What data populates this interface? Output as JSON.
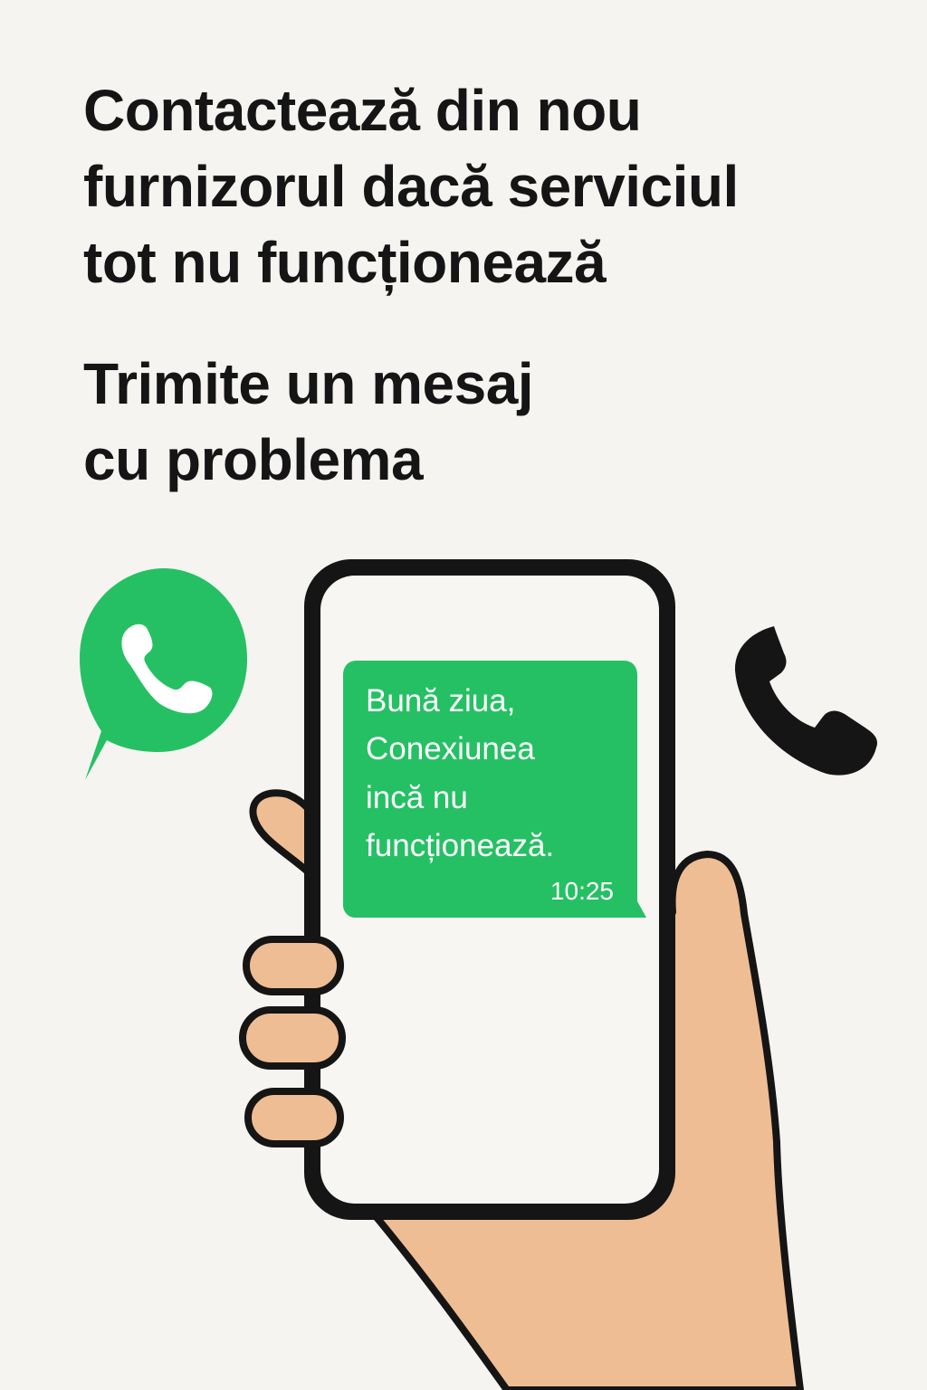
{
  "headline": {
    "lines": [
      "Contactează din nou",
      "furnizorul dacă serviciul",
      "tot nu funcționează"
    ]
  },
  "subheadline": {
    "lines": [
      "Trimite un mesaj",
      "cu problema"
    ]
  },
  "message": {
    "lines": [
      "Bună ziua,",
      "Conexiunea",
      "incă nu",
      "funcționează."
    ],
    "time": "10:25"
  },
  "icons": {
    "whatsapp": "whatsapp-logo-icon",
    "phone": "phone-handset-icon"
  },
  "colors": {
    "background": "#f5f4f0",
    "text": "#151515",
    "message_bubble": "#25c063",
    "whatsapp_green": "#25c063",
    "phone_outline": "#151515",
    "screen": "#f7f6f2",
    "skin": "#efbd93"
  }
}
